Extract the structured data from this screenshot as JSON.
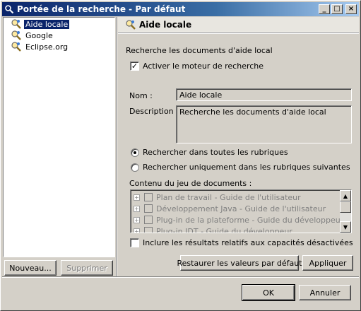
{
  "window": {
    "title": "Portée de la recherche - Par défaut",
    "minimize_glyph": "_",
    "maximize_glyph": "□",
    "close_glyph": "×"
  },
  "tree": {
    "items": [
      {
        "label": "Aide locale",
        "selected": true
      },
      {
        "label": "Google",
        "selected": false
      },
      {
        "label": "Eclipse.org",
        "selected": false
      }
    ]
  },
  "left_buttons": {
    "new": "Nouveau...",
    "delete": "Supprimer"
  },
  "header": {
    "title": "Aide locale"
  },
  "form": {
    "description_line": "Recherche les documents d'aide local",
    "enable_engine": {
      "label": "Activer le moteur de recherche",
      "checked": true
    },
    "name_label": "Nom :",
    "name_value": "Aide locale",
    "description_label": "Description :",
    "description_value": "Recherche les documents d'aide local",
    "radio_all": {
      "label": "Rechercher dans toutes les rubriques",
      "selected": true
    },
    "radio_some": {
      "label": "Rechercher uniquement dans les rubriques suivantes",
      "selected": false
    },
    "docset_label": "Contenu du jeu de documents :",
    "docs": [
      "Plan de travail - Guide de l'utilisateur",
      "Développement Java - Guide de l'utilisateur",
      "Plug-in de la plateforme - Guide du développeur",
      "Plug-in JDT - Guide du développeur"
    ],
    "include_disabled": {
      "label": "Inclure les résultats relatifs aux capacités désactivées",
      "checked": false
    }
  },
  "buttons": {
    "restore_defaults": "Restaurer les valeurs par défaut",
    "apply": "Appliquer",
    "ok": "OK",
    "cancel": "Annuler"
  },
  "colors": {
    "selection": "#0a246a",
    "title_gradient_start": "#0a246a",
    "face": "#d4d0c8"
  }
}
